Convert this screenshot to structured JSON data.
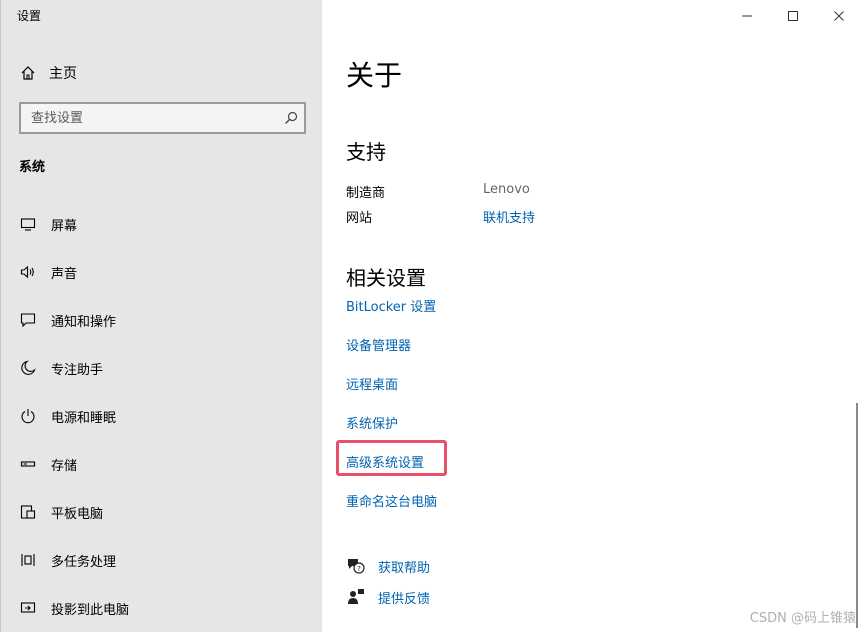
{
  "app": {
    "title": "设置"
  },
  "window": {
    "minimize": "minimize",
    "maximize": "maximize",
    "close": "close"
  },
  "sidebar": {
    "home_label": "主页",
    "search_placeholder": "查找设置",
    "section": "系统",
    "items": [
      {
        "label": "屏幕",
        "icon": "monitor-icon"
      },
      {
        "label": "声音",
        "icon": "speaker-icon"
      },
      {
        "label": "通知和操作",
        "icon": "notification-icon"
      },
      {
        "label": "专注助手",
        "icon": "moon-icon"
      },
      {
        "label": "电源和睡眠",
        "icon": "power-icon"
      },
      {
        "label": "存储",
        "icon": "storage-icon"
      },
      {
        "label": "平板电脑",
        "icon": "tablet-icon"
      },
      {
        "label": "多任务处理",
        "icon": "multitask-icon"
      },
      {
        "label": "投影到此电脑",
        "icon": "project-icon"
      }
    ]
  },
  "main": {
    "title": "关于",
    "support": {
      "heading": "支持",
      "rows": [
        {
          "label": "制造商",
          "value": "Lenovo"
        },
        {
          "label": "网站",
          "value": "联机支持"
        }
      ]
    },
    "related": {
      "heading": "相关设置",
      "links": [
        "BitLocker 设置",
        "设备管理器",
        "远程桌面",
        "系统保护",
        "高级系统设置",
        "重命名这台电脑"
      ]
    },
    "help": {
      "get_help": "获取帮助",
      "feedback": "提供反馈"
    }
  },
  "watermark": "CSDN @码上锥猿",
  "colors": {
    "link": "#0063b1",
    "highlight": "#e8506a",
    "sidebar_bg": "#e6e6e6"
  }
}
